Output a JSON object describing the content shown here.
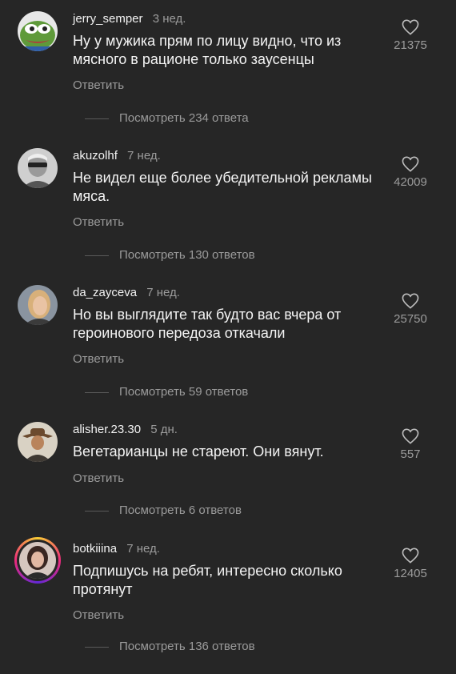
{
  "comments": [
    {
      "username": "jerry_semper",
      "time": "3 нед.",
      "text": "Ну у мужика прям по лицу видно, что из мясного в рационе только заусенцы",
      "reply": "Ответить",
      "view_replies": "Посмотреть 234 ответа",
      "likes": "21375",
      "avatar_icon": "pepe-frog-avatar"
    },
    {
      "username": "akuzolhf",
      "time": "7 нед.",
      "text": "Не видел еще более убедительной рекламы мяса.",
      "reply": "Ответить",
      "view_replies": "Посмотреть 130 ответов",
      "likes": "42009",
      "avatar_icon": "bw-portrait-avatar"
    },
    {
      "username": "da_zayceva",
      "time": "7 нед.",
      "text": "Но вы выглядите так будто вас вчера от героинового передоза откачали",
      "reply": "Ответить",
      "view_replies": "Посмотреть 59 ответов",
      "likes": "25750",
      "avatar_icon": "blonde-portrait-avatar"
    },
    {
      "username": "alisher.23.30",
      "time": "5 дн.",
      "text": "Вегетарианцы не стареют. Они вянут.",
      "reply": "Ответить",
      "view_replies": "Посмотреть 6 ответов",
      "likes": "557",
      "avatar_icon": "cowboy-portrait-avatar"
    },
    {
      "username": "botkiiina",
      "time": "7 нед.",
      "text": "Подпишусь на ребят, интересно сколько протянут",
      "reply": "Ответить",
      "view_replies": "Посмотреть 136 ответов",
      "likes": "12405",
      "avatar_icon": "woman-portrait-avatar",
      "has_story_ring": true
    }
  ],
  "colors": {
    "background": "#262626",
    "text": "#f4f4f4",
    "muted": "#9b9b9b"
  }
}
